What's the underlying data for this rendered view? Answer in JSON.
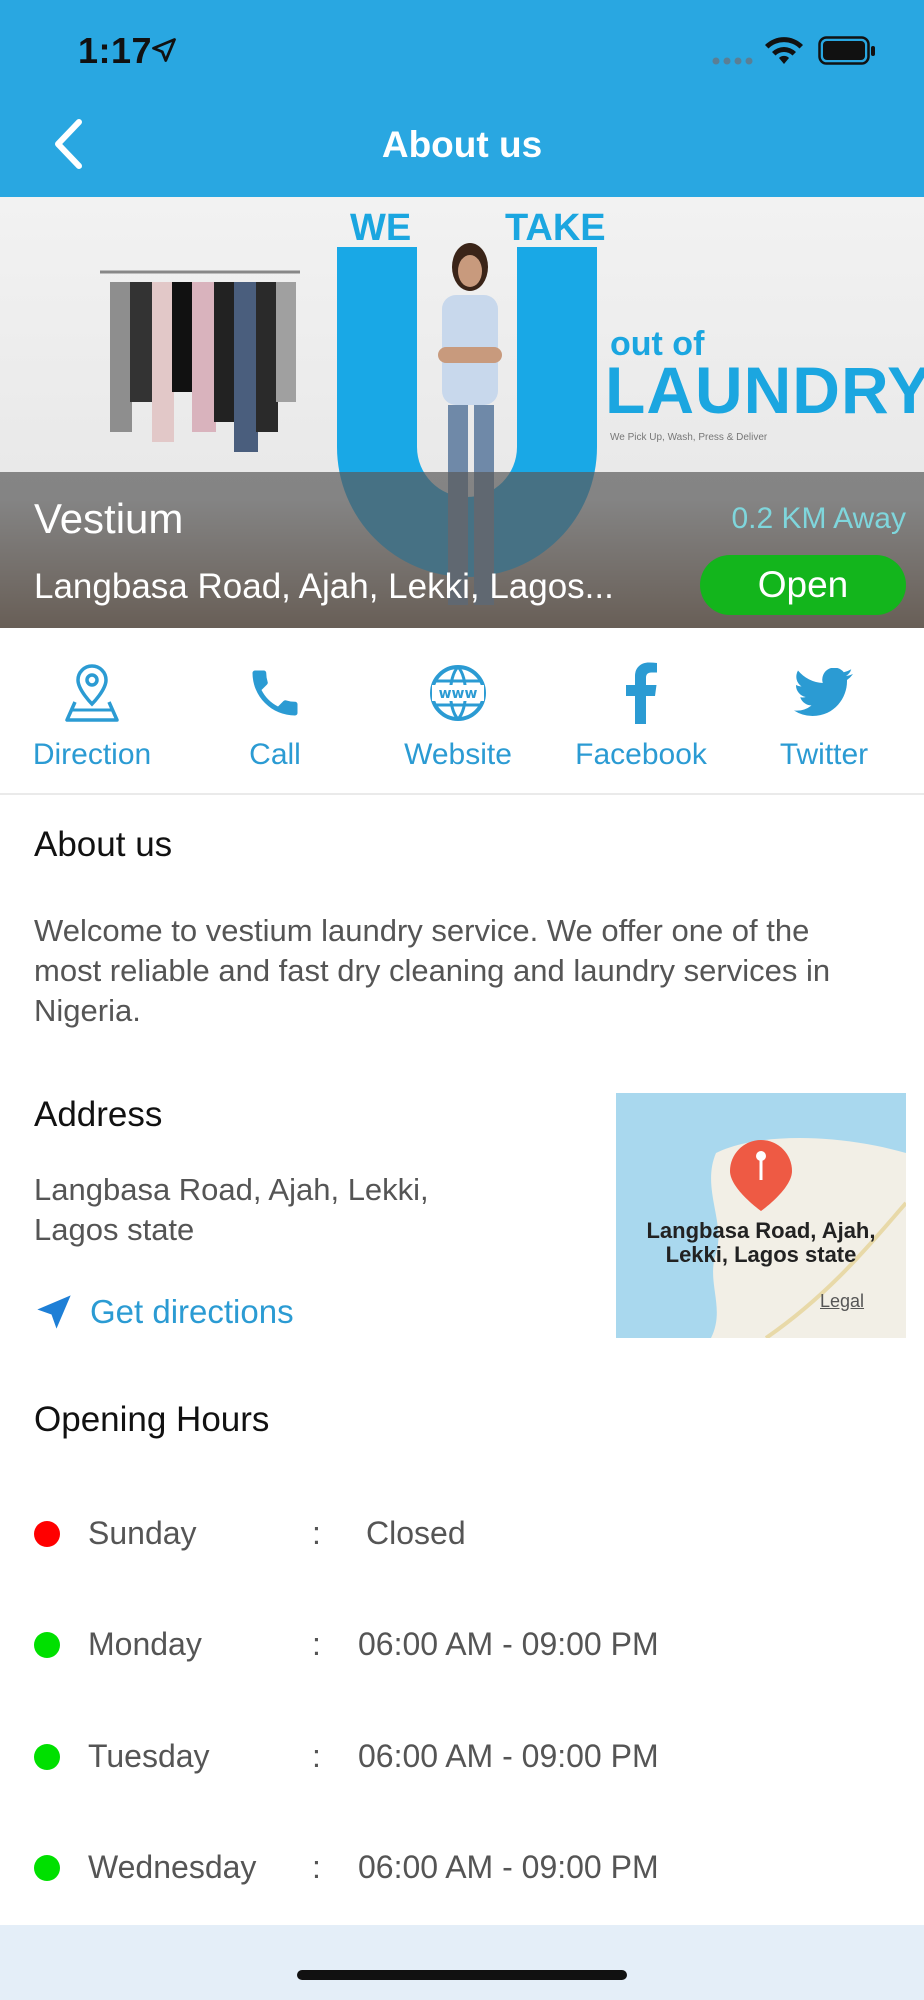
{
  "status_bar": {
    "time": "1:17"
  },
  "header": {
    "title": "About us"
  },
  "hero": {
    "banner_we": "WE",
    "banner_take": "TAKE",
    "banner_out_of": "out of",
    "banner_laundry": "LAUNDRY",
    "banner_tagline": "We Pick Up, Wash, Press & Deliver",
    "business_name": "Vestium",
    "distance": "0.2 KM Away",
    "address": "Langbasa Road, Ajah, Lekki, Lagos...",
    "status": "Open",
    "status_color": "#13b51c"
  },
  "actions": [
    {
      "label": "Direction",
      "icon": "map-pin-icon"
    },
    {
      "label": "Call",
      "icon": "phone-icon"
    },
    {
      "label": "Website",
      "icon": "globe-www-icon"
    },
    {
      "label": "Facebook",
      "icon": "facebook-icon"
    },
    {
      "label": "Twitter",
      "icon": "twitter-icon"
    }
  ],
  "about": {
    "title": "About us",
    "text": "Welcome to vestium laundry service. We offer one of the most reliable and fast dry cleaning and laundry services in Nigeria."
  },
  "address": {
    "title": "Address",
    "text": "Langbasa Road, Ajah, Lekki, Lagos state",
    "directions_label": "Get directions",
    "map_label_line1": "Langbasa Road, Ajah,",
    "map_label_line2": "Lekki, Lagos state",
    "map_legal": "Legal"
  },
  "hours": {
    "title": "Opening Hours",
    "rows": [
      {
        "day": "Sunday",
        "sep": ":",
        "value": "Closed",
        "color": "#ff0000"
      },
      {
        "day": "Monday",
        "sep": ":",
        "value": "06:00 AM - 09:00 PM",
        "color": "#00e000"
      },
      {
        "day": "Tuesday",
        "sep": ":",
        "value": "06:00 AM - 09:00 PM",
        "color": "#00e000"
      },
      {
        "day": "Wednesday",
        "sep": ":",
        "value": "06:00 AM - 09:00 PM",
        "color": "#00e000"
      }
    ]
  },
  "colors": {
    "accent": "#29a7e1",
    "link": "#2b9bd3"
  }
}
